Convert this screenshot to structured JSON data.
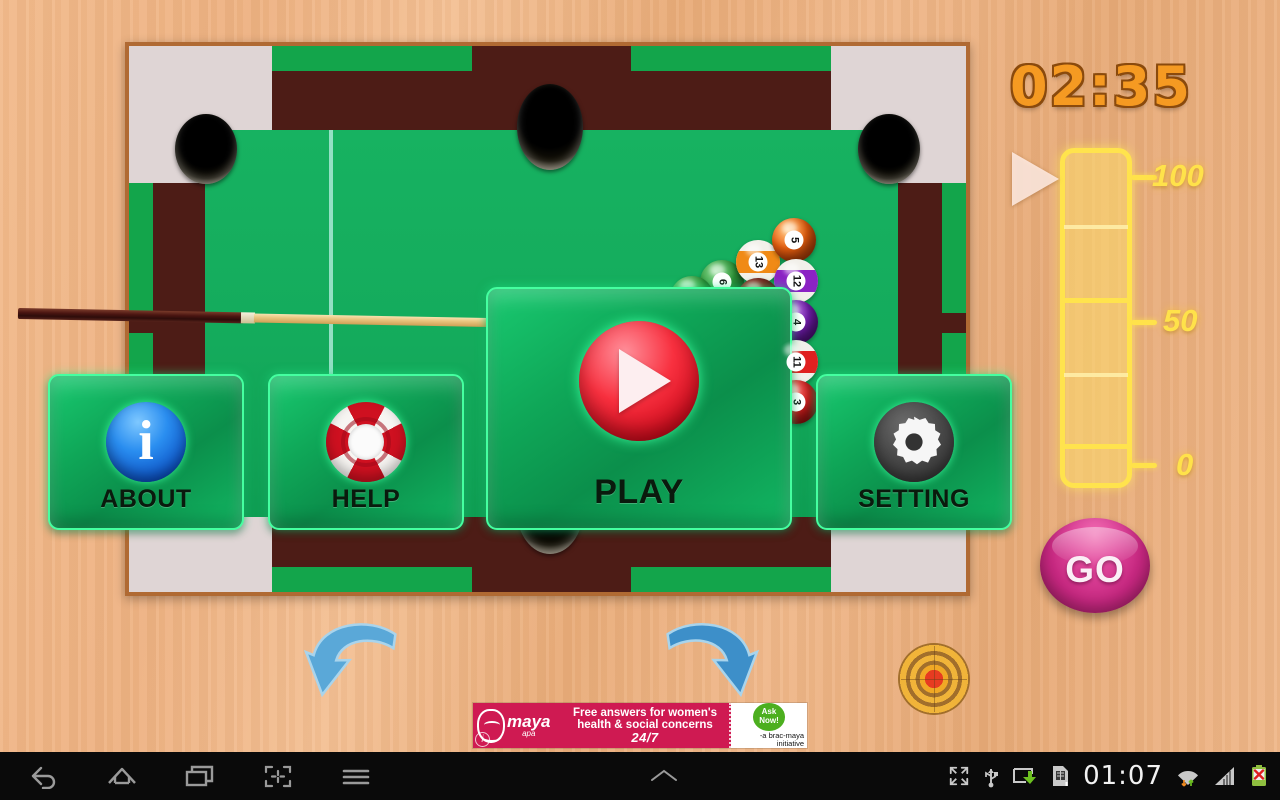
{
  "game": {
    "timer": "02:35",
    "menu_buttons": [
      {
        "id": "about",
        "label": "ABOUT",
        "icon": "info-icon"
      },
      {
        "id": "help",
        "label": "HELP",
        "icon": "lifebuoy-icon"
      },
      {
        "id": "play",
        "label": "PLAY",
        "icon": "play-icon"
      },
      {
        "id": "setting",
        "label": "SETTING",
        "icon": "gear-icon"
      }
    ],
    "power_slider": {
      "name": "power-slider",
      "tick_labels": [
        "100",
        "50",
        "0"
      ],
      "max": 100,
      "min": 0,
      "current_value": 100
    },
    "go_button": {
      "label": "GO",
      "color": "#c5277f"
    },
    "controls": [
      {
        "name": "spin-left-arrow",
        "icon": "rotate-left-icon"
      },
      {
        "name": "spin-right-arrow",
        "icon": "rotate-right-icon"
      },
      {
        "name": "aim-target",
        "icon": "target-icon"
      }
    ],
    "balls": [
      {
        "number": "6",
        "type": "solid",
        "color": "#2f9e3b"
      },
      {
        "number": "13",
        "type": "stripe",
        "color": "#f08a16"
      },
      {
        "number": "5",
        "type": "solid",
        "color": "#f0620f"
      },
      {
        "number": "12",
        "type": "stripe",
        "color": "#8b22c4"
      },
      {
        "number": "4",
        "type": "solid",
        "color": "#7a1fb8"
      },
      {
        "number": "11",
        "type": "stripe",
        "color": "#e02020"
      },
      {
        "number": "3",
        "type": "solid",
        "color": "#e02020"
      }
    ],
    "table": {
      "felt_color": "#14ab5c",
      "rail_color": "#4d1c16",
      "frame_color": "#dfd5d5"
    }
  },
  "ad": {
    "brand": "maya",
    "brand_sub": "apa",
    "line1": "Free answers for women's",
    "line2": "health & social concerns",
    "line3": "24/7",
    "cta_line1": "Ask",
    "cta_line2": "Now!",
    "initiative_line1": "-a brac-maya",
    "initiative_line2": "initiative",
    "info_badge": "i"
  },
  "navbar": {
    "buttons": [
      {
        "name": "back-button",
        "icon": "back-icon"
      },
      {
        "name": "home-button",
        "icon": "home-icon"
      },
      {
        "name": "recents-button",
        "icon": "recents-icon"
      },
      {
        "name": "screenshot-button",
        "icon": "shrink-icon"
      },
      {
        "name": "menu-button",
        "icon": "hamburger-icon"
      }
    ],
    "expand_handle": {
      "name": "expand-chevron",
      "icon": "chevron-up-icon"
    },
    "status": {
      "clock": "01:07",
      "icons": [
        "fullscreen-icon",
        "usb-icon",
        "screencast-icon",
        "sim-card-icon",
        "wifi-icon",
        "signal-icon",
        "battery-error-icon"
      ]
    }
  }
}
